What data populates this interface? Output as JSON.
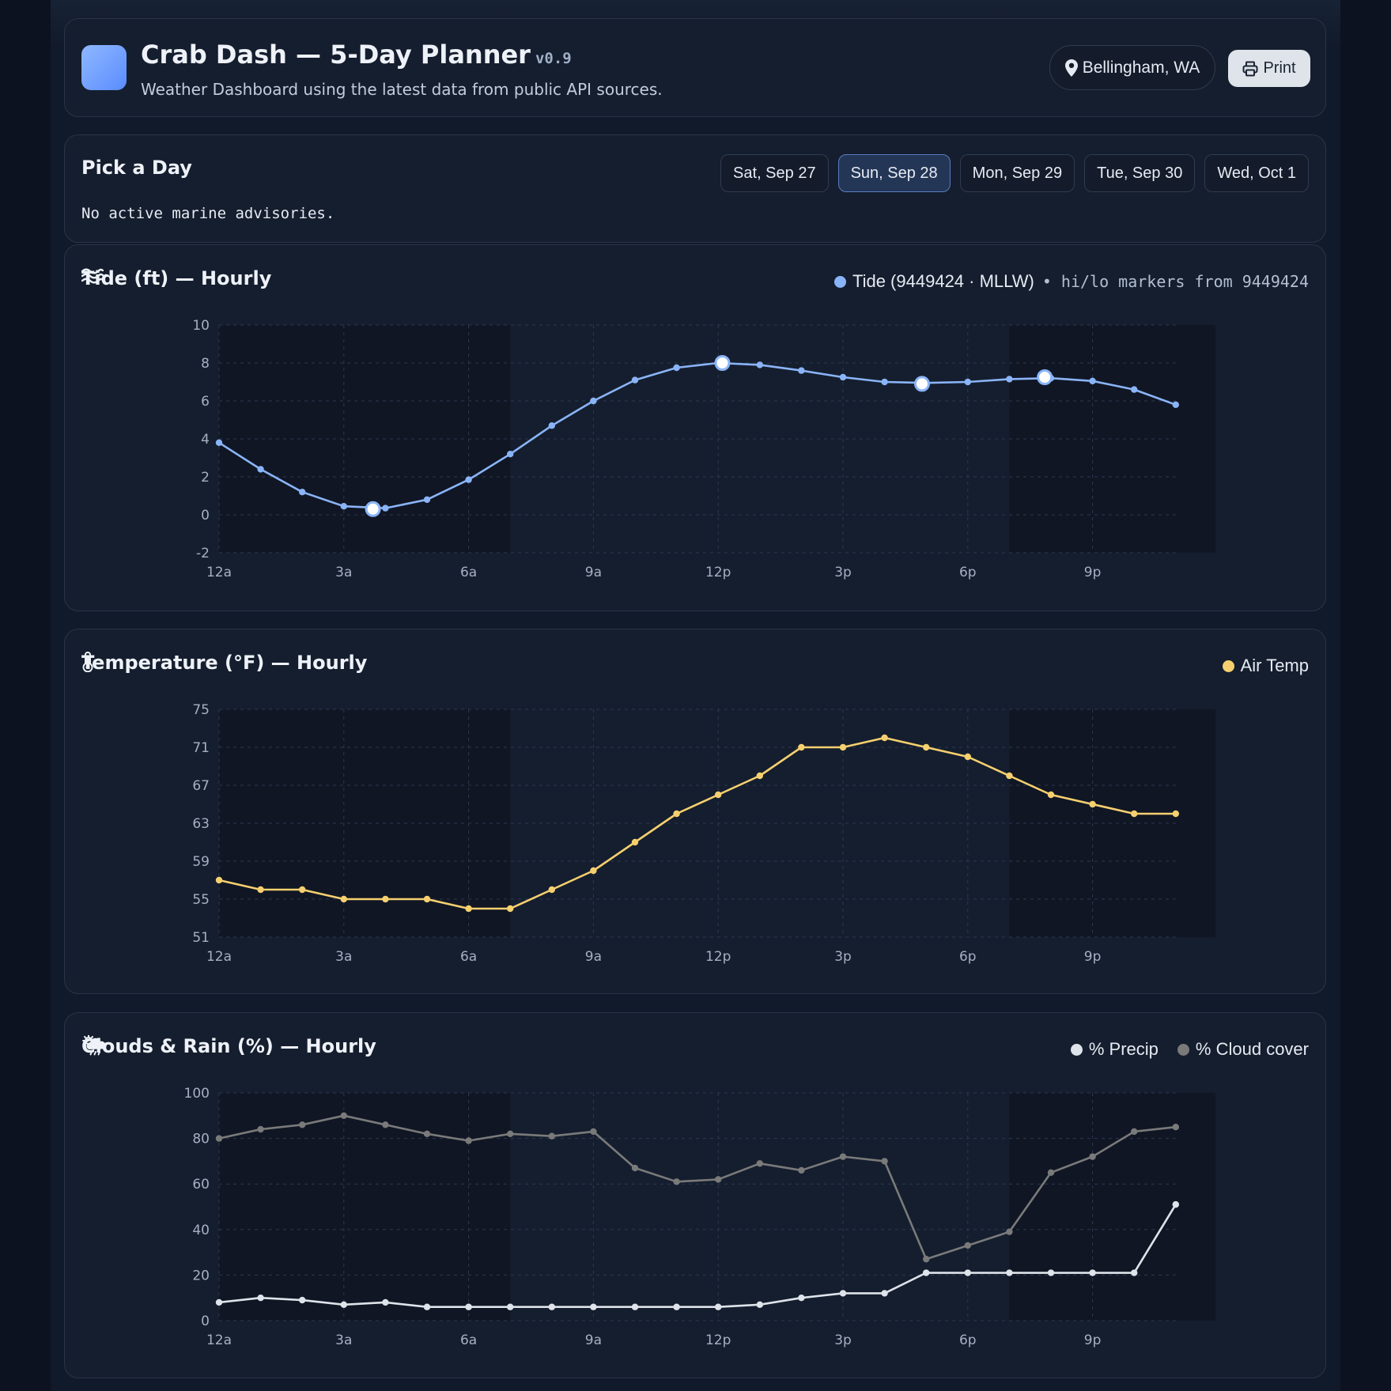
{
  "header": {
    "title": "Crab Dash — 5-Day Planner",
    "version": "v0.9",
    "subtitle": "Weather Dashboard using the latest data from public API sources.",
    "location": "Bellingham, WA",
    "print_label": "Print",
    "logo_color": "#6f9cff"
  },
  "picker": {
    "title": "Pick a Day",
    "days": [
      "Sat, Sep 27",
      "Sun, Sep 28",
      "Mon, Sep 29",
      "Tue, Sep 30",
      "Wed, Oct 1"
    ],
    "selected": "Sun, Sep 28",
    "advisory": "No active marine advisories."
  },
  "tide": {
    "title": "Tide (ft) — Hourly",
    "icon": "waves-icon",
    "legend_label": "Tide (9449424 · MLLW)",
    "legend_note": "• hi/lo markers from 9449424"
  },
  "temp": {
    "title": "Temperature (°F) — Hourly",
    "icon": "thermometer-icon",
    "legend_label": "Air Temp"
  },
  "clouds": {
    "title": "Clouds & Rain (%) — Hourly",
    "icon": "cloud-rain-icon",
    "legend_precip": "% Precip",
    "legend_cloud": "% Cloud cover"
  },
  "chart_data": [
    {
      "type": "line",
      "hours": [
        0,
        1,
        2,
        3,
        4,
        5,
        6,
        7,
        8,
        9,
        10,
        11,
        12,
        13,
        14,
        15,
        16,
        17,
        18,
        19,
        20,
        21,
        22,
        23
      ],
      "x_tick_hours": [
        0,
        3,
        6,
        9,
        12,
        15,
        18,
        21
      ],
      "x_ticks": [
        "12a",
        "3a",
        "6a",
        "9a",
        "12p",
        "3p",
        "6p",
        "9p"
      ],
      "night_spans": [
        [
          0,
          7
        ],
        [
          19,
          24
        ]
      ],
      "ylim": [
        -2,
        10
      ],
      "y_ticks": [
        -2,
        0,
        2,
        4,
        6,
        8,
        10
      ],
      "series": [
        {
          "name": "Tide (9449424 · MLLW)",
          "color": "#8ab4f8",
          "values": [
            3.8,
            2.4,
            1.2,
            0.45,
            0.35,
            0.8,
            1.85,
            3.2,
            4.7,
            6.0,
            7.1,
            7.75,
            8.0,
            7.9,
            7.6,
            7.25,
            7.0,
            6.95,
            7.0,
            7.15,
            7.2,
            7.05,
            6.6,
            5.8
          ]
        }
      ],
      "hilo_markers": [
        {
          "hour": 3.7,
          "value": 0.3
        },
        {
          "hour": 12.1,
          "value": 8.0
        },
        {
          "hour": 16.9,
          "value": 6.9
        },
        {
          "hour": 19.85,
          "value": 7.25
        }
      ]
    },
    {
      "type": "line",
      "hours": [
        0,
        1,
        2,
        3,
        4,
        5,
        6,
        7,
        8,
        9,
        10,
        11,
        12,
        13,
        14,
        15,
        16,
        17,
        18,
        19,
        20,
        21,
        22,
        23
      ],
      "x_tick_hours": [
        0,
        3,
        6,
        9,
        12,
        15,
        18,
        21
      ],
      "x_ticks": [
        "12a",
        "3a",
        "6a",
        "9a",
        "12p",
        "3p",
        "6p",
        "9p"
      ],
      "night_spans": [
        [
          0,
          7
        ],
        [
          19,
          24
        ]
      ],
      "ylim": [
        51,
        75
      ],
      "y_ticks": [
        51,
        55,
        59,
        63,
        67,
        71,
        75
      ],
      "series": [
        {
          "name": "Air Temp",
          "color": "#f6d06f",
          "values": [
            57,
            56,
            56,
            55,
            55,
            55,
            54,
            54,
            56,
            58,
            61,
            64,
            66,
            68,
            71,
            71,
            72,
            71,
            70,
            68,
            66,
            65,
            64,
            64
          ]
        }
      ]
    },
    {
      "type": "line",
      "hours": [
        0,
        1,
        2,
        3,
        4,
        5,
        6,
        7,
        8,
        9,
        10,
        11,
        12,
        13,
        14,
        15,
        16,
        17,
        18,
        19,
        20,
        21,
        22,
        23
      ],
      "x_tick_hours": [
        0,
        3,
        6,
        9,
        12,
        15,
        18,
        21
      ],
      "x_ticks": [
        "12a",
        "3a",
        "6a",
        "9a",
        "12p",
        "3p",
        "6p",
        "9p"
      ],
      "night_spans": [
        [
          0,
          7
        ],
        [
          19,
          24
        ]
      ],
      "ylim": [
        0,
        100
      ],
      "y_ticks": [
        0,
        20,
        40,
        60,
        80,
        100
      ],
      "series": [
        {
          "name": "% Precip",
          "color": "#dfe3ea",
          "values": [
            8,
            10,
            9,
            7,
            8,
            6,
            6,
            6,
            6,
            6,
            6,
            6,
            6,
            7,
            10,
            12,
            12,
            21,
            21,
            21,
            21,
            21,
            21,
            51
          ]
        },
        {
          "name": "% Cloud cover",
          "color": "#7a7a7a",
          "values": [
            80,
            84,
            86,
            90,
            86,
            82,
            79,
            82,
            81,
            83,
            67,
            61,
            62,
            69,
            66,
            72,
            70,
            27,
            33,
            39,
            65,
            72,
            83,
            85
          ]
        }
      ]
    }
  ]
}
